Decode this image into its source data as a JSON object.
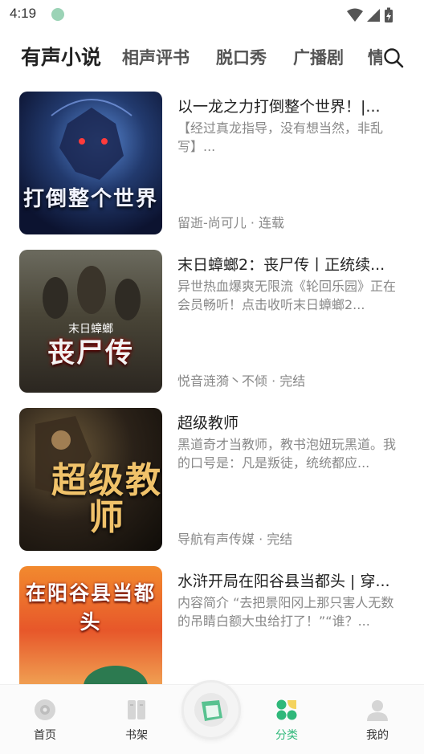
{
  "status_bar": {
    "time": "4:19"
  },
  "tabs": [
    {
      "label": "有声小说",
      "active": true
    },
    {
      "label": "相声评书",
      "active": false
    },
    {
      "label": "脱口秀",
      "active": false
    },
    {
      "label": "广播剧",
      "active": false
    },
    {
      "label": "情",
      "active": false
    }
  ],
  "books": [
    {
      "title": "以一龙之力打倒整个世界！|...",
      "description": "【经过真龙指导，没有想当然，非乱写】...",
      "meta": "留逝-尚可儿 · 连载",
      "cover_text": "打倒整个世界"
    },
    {
      "title": "末日蟑螂2：丧尸传丨正统续...",
      "description": "异世热血爆爽无限流《轮回乐园》正在会员畅听！点击收听末日蟑螂2...",
      "meta": "悦音涟漪丶不倾 · 完结",
      "cover_text": "丧尸传",
      "cover_subtext": "末日蟑螂"
    },
    {
      "title": "超级教师",
      "description": "黑道奇才当教师，教书泡妞玩黑道。我的口号是：凡是叛徒，统统都应...",
      "meta": "导航有声传媒 · 完结",
      "cover_text": "超级教师"
    },
    {
      "title": "水浒开局在阳谷县当都头 | 穿...",
      "description": "内容简介 “去把景阳冈上那只害人无数的吊睛白额大虫给打了！”“谁？...",
      "meta": "",
      "cover_text": "在阳谷县当都头"
    }
  ],
  "bottom_nav": [
    {
      "label": "首页",
      "icon": "home-disc-icon",
      "active": false
    },
    {
      "label": "书架",
      "icon": "bookshelf-icon",
      "active": false
    },
    {
      "label": "分类",
      "icon": "category-icon",
      "active": true
    },
    {
      "label": "我的",
      "icon": "profile-icon",
      "active": false
    }
  ],
  "colors": {
    "accent": "#2fb87a",
    "text_primary": "#222222",
    "text_secondary": "#888888"
  }
}
